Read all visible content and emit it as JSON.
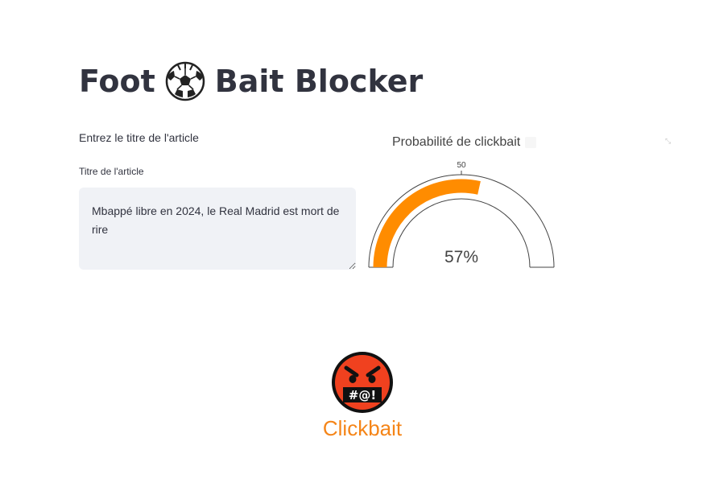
{
  "app": {
    "title_before": "Foot",
    "title_icon": "soccer-ball-icon",
    "title_after": "Bait Blocker"
  },
  "form": {
    "section_label": "Entrez le titre de l'article",
    "field_label": "Titre de l'article",
    "field_value": "Mbappé libre en 2024, le Real Madrid est mort de rire"
  },
  "gauge": {
    "title": "Probabilité de clickbait",
    "tick_label": "50",
    "value_text": "57%",
    "value": 57,
    "range": [
      0,
      100
    ],
    "bar_color": "#ff8c00"
  },
  "result": {
    "icon": "cursing-face-icon",
    "label": "Clickbait",
    "label_color": "#f58518"
  }
}
